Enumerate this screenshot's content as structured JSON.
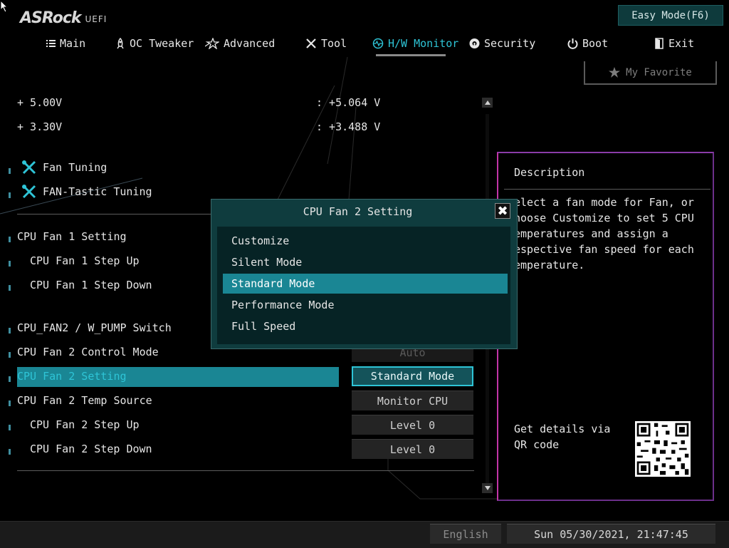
{
  "header": {
    "logo_main": "ASRock",
    "logo_sub": "UEFI",
    "easy_mode_label": "Easy Mode(F6)",
    "my_favorite_label": "My Favorite"
  },
  "tabs": [
    {
      "label": "Main",
      "icon": "list-icon"
    },
    {
      "label": "OC Tweaker",
      "icon": "rocket-icon"
    },
    {
      "label": "Advanced",
      "icon": "star-icon"
    },
    {
      "label": "Tool",
      "icon": "tools-icon"
    },
    {
      "label": "H/W Monitor",
      "icon": "monitor-icon",
      "active": true
    },
    {
      "label": "Security",
      "icon": "shield-icon"
    },
    {
      "label": "Boot",
      "icon": "power-icon"
    },
    {
      "label": "Exit",
      "icon": "exit-door-icon"
    }
  ],
  "voltages": [
    {
      "label": "+ 5.00V",
      "value": ": +5.064 V"
    },
    {
      "label": "+ 3.30V",
      "value": ": +3.488 V"
    }
  ],
  "items": {
    "fan_tuning": "Fan Tuning",
    "fantastic_tuning": "FAN-Tastic Tuning",
    "cpu_fan1_setting": "CPU Fan 1 Setting",
    "cpu_fan1_step_up": "CPU Fan 1 Step Up",
    "cpu_fan1_step_down": "CPU Fan 1 Step Down",
    "cpu_fan2_switch": "CPU_FAN2 / W_PUMP Switch",
    "cpu_fan2_control_mode": "CPU Fan 2 Control Mode",
    "cpu_fan2_setting": "CPU Fan 2 Setting",
    "cpu_fan2_temp_source": "CPU Fan 2 Temp Source",
    "cpu_fan2_step_up": "CPU Fan 2 Step Up",
    "cpu_fan2_step_down": "CPU Fan 2 Step Down"
  },
  "values": {
    "control_mode": "Auto",
    "fan2_setting": "Standard Mode",
    "temp_source": "Monitor CPU",
    "step_up": "Level 0",
    "step_down": "Level 0"
  },
  "dialog": {
    "title": "CPU Fan 2 Setting",
    "close_glyph": "✖",
    "options": [
      "Customize",
      "Silent Mode",
      "Standard Mode",
      "Performance Mode",
      "Full Speed"
    ],
    "selected": "Standard Mode"
  },
  "description": {
    "title": "Description",
    "text": "elect a fan mode for Fan, or\nhoose Customize to set 5 CPU\nemperatures and assign a\nespective fan speed for each\nemperature.",
    "qr_label": "Get details via QR code"
  },
  "footer": {
    "language": "English",
    "datetime": "Sun 05/30/2021, 21:47:45"
  },
  "colors": {
    "accent": "#2ec4d6",
    "selection": "#1a8694",
    "dialog_bg": "#0f3c3e"
  }
}
